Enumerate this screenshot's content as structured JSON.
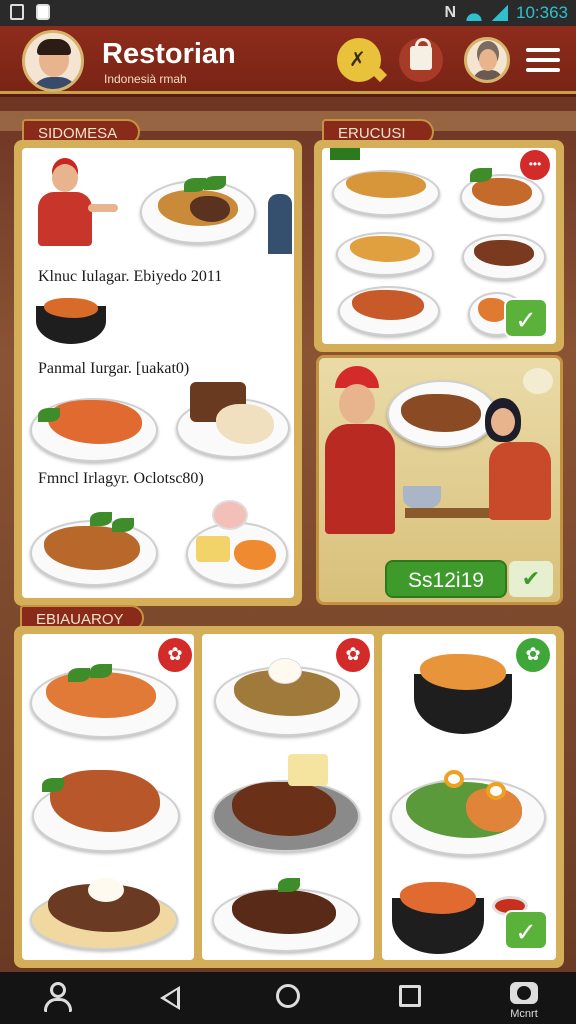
{
  "status_bar": {
    "notification": "N",
    "time": "10:363"
  },
  "header": {
    "title": "Restorian",
    "subtitle": "Indonesià rmah"
  },
  "sections": {
    "top_left": {
      "tab_label": "SIDOMESA",
      "captions": [
        "Klnuc Iulagar. Ebiyedo 2011",
        "Panmal Iurgar. [uakat0)",
        "Fmncl Irlagyr. Oclotsc80)"
      ]
    },
    "top_right": {
      "tab_label": "ERUCUSI",
      "badge_text": "•••"
    },
    "promo": {
      "price_label": "Ss12i19",
      "next_icon": "arrow-icon"
    },
    "bottom": {
      "tab_label": "EBIAUAROY"
    }
  },
  "bottom_nav": {
    "account_label": "Mcnrt"
  },
  "colors": {
    "header": "#8e2c1c",
    "panel_gold": "#d4ae58",
    "accent_green": "#3e9a2a",
    "badge_red": "#d32a2a"
  }
}
